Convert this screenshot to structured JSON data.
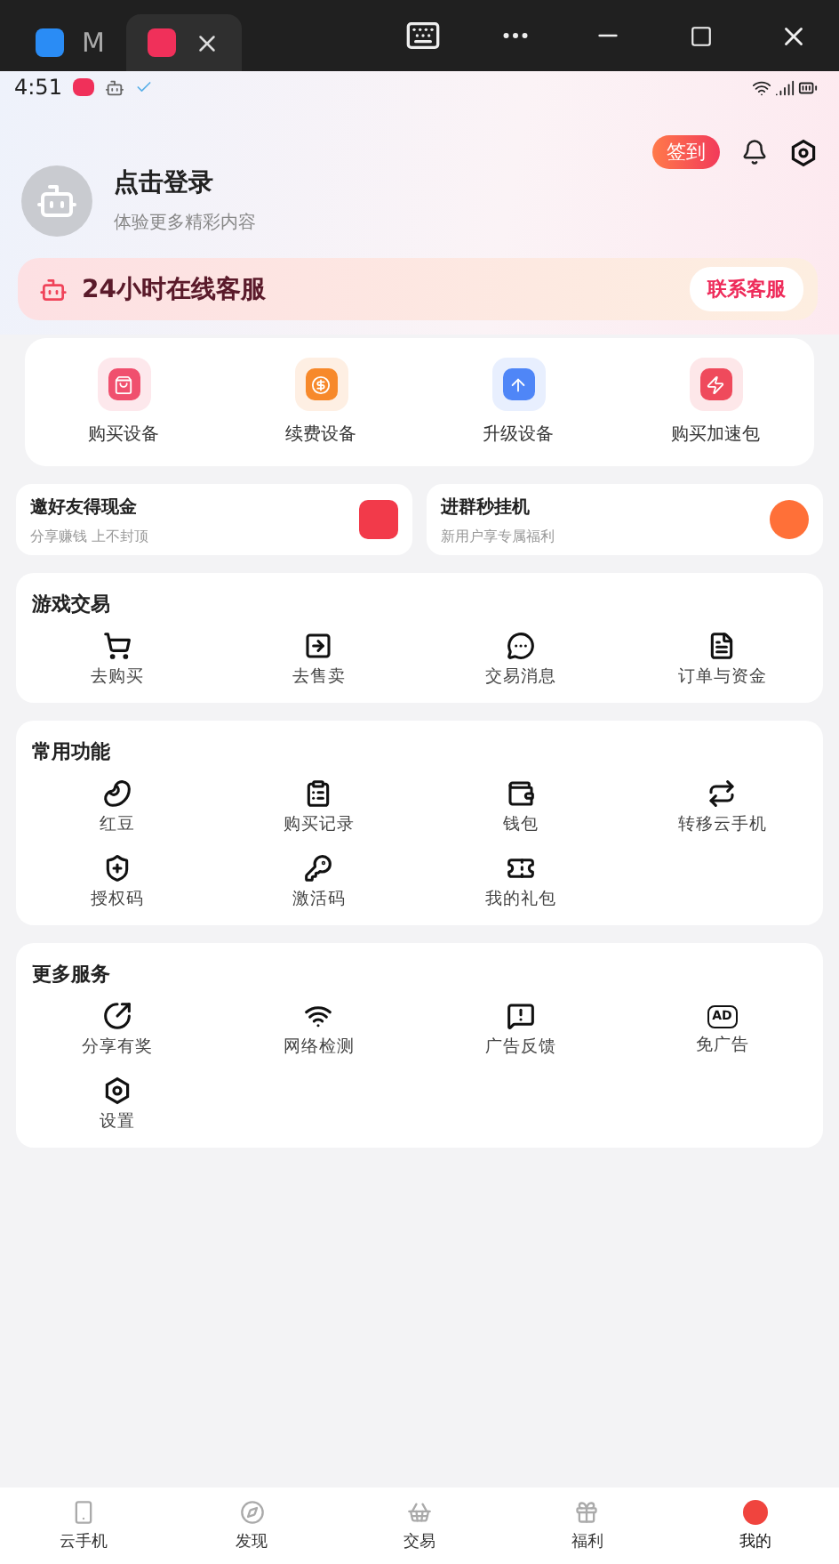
{
  "window": {
    "tabs": [
      {
        "label": "M",
        "selected": false
      },
      {
        "selected": true
      }
    ]
  },
  "status_bar": {
    "time": "4:51"
  },
  "header": {
    "checkin": "签到"
  },
  "profile": {
    "title": "点击登录",
    "subtitle": "体验更多精彩内容"
  },
  "service_banner": {
    "title": "24小时在线客服",
    "button": "联系客服"
  },
  "quick_actions": [
    {
      "label": "购买设备",
      "color": "#f0506e"
    },
    {
      "label": "续费设备",
      "color": "#f7892b"
    },
    {
      "label": "升级设备",
      "color": "#4f86f7"
    },
    {
      "label": "购买加速包",
      "color": "#ef4a5c"
    }
  ],
  "promos": [
    {
      "title": "邀好友得现金",
      "subtitle": "分享赚钱 上不封顶"
    },
    {
      "title": "进群秒挂机",
      "subtitle": "新用户享专属福利"
    }
  ],
  "sections": [
    {
      "title": "游戏交易",
      "items": [
        {
          "label": "去购买"
        },
        {
          "label": "去售卖"
        },
        {
          "label": "交易消息"
        },
        {
          "label": "订单与资金"
        }
      ]
    },
    {
      "title": "常用功能",
      "items": [
        {
          "label": "红豆"
        },
        {
          "label": "购买记录"
        },
        {
          "label": "钱包"
        },
        {
          "label": "转移云手机"
        },
        {
          "label": "授权码"
        },
        {
          "label": "激活码"
        },
        {
          "label": "我的礼包"
        }
      ]
    },
    {
      "title": "更多服务",
      "items": [
        {
          "label": "分享有奖"
        },
        {
          "label": "网络检测"
        },
        {
          "label": "广告反馈"
        },
        {
          "label": "免广告",
          "icon_text": "AD"
        },
        {
          "label": "设置"
        }
      ]
    }
  ],
  "bottom_nav": [
    {
      "label": "云手机",
      "selected": false
    },
    {
      "label": "发现",
      "selected": false
    },
    {
      "label": "交易",
      "selected": false
    },
    {
      "label": "福利",
      "selected": false
    },
    {
      "label": "我的",
      "selected": true
    }
  ]
}
